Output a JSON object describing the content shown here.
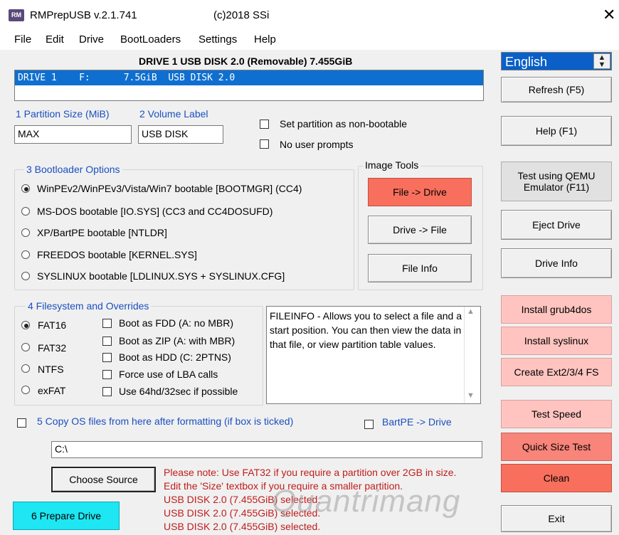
{
  "window": {
    "app_icon": "RM",
    "title": "RMPrepUSB v.2.1.741",
    "copyright": "(c)2018 SSi",
    "close_icon": "close-icon"
  },
  "menu": [
    "File",
    "Edit",
    "Drive",
    "BootLoaders",
    "Settings",
    "Help"
  ],
  "drive_header": "DRIVE 1 USB DISK 2.0  (Removable) 7.455GiB",
  "drive_list_row": "DRIVE 1    F:      7.5GiB  USB DISK 2.0",
  "language": {
    "value": "English"
  },
  "fields": {
    "partition_size_label": "1 Partition Size (MiB)",
    "partition_size_value": "MAX",
    "volume_label_label": "2 Volume Label",
    "volume_label_value": "USB DISK"
  },
  "options": {
    "non_bootable": "Set partition as non-bootable",
    "no_prompts": "No user prompts"
  },
  "bootloader": {
    "title": "3 Bootloader Options",
    "items": [
      "WinPEv2/WinPEv3/Vista/Win7 bootable [BOOTMGR] (CC4)",
      "MS-DOS bootable [IO.SYS]   (CC3 and CC4DOSUFD)",
      "XP/BartPE bootable [NTLDR]",
      "FREEDOS bootable [KERNEL.SYS]",
      "SYSLINUX bootable [LDLINUX.SYS + SYSLINUX.CFG]"
    ],
    "selected_index": 0
  },
  "image_tools": {
    "title": "Image Tools",
    "file_to_drive": "File -> Drive",
    "drive_to_file": "Drive -> File",
    "file_info": "File Info"
  },
  "filesystem": {
    "title": "4 Filesystem and Overrides",
    "types": [
      "FAT16",
      "FAT32",
      "NTFS",
      "exFAT"
    ],
    "selected_index": 0,
    "overrides": [
      "Boot as FDD (A: no MBR)",
      "Boot as ZIP (A: with MBR)",
      "Boot as HDD (C: 2PTNS)",
      "Force use of LBA calls",
      "Use 64hd/32sec if possible"
    ]
  },
  "info_text": "FILEINFO - Allows you to select a file and a start position. You can then view the data in that file, or view partition table values.",
  "copy_os": {
    "label": "5 Copy OS files from here after formatting (if box is ticked)",
    "bartpe_label": "BartPE -> Drive",
    "path_value": "C:\\"
  },
  "buttons": {
    "refresh": "Refresh (F5)",
    "help": "Help (F1)",
    "qemu": "Test using QEMU Emulator (F11)",
    "eject": "Eject Drive",
    "drive_info": "Drive Info",
    "grub4dos": "Install grub4dos",
    "syslinux": "Install syslinux",
    "ext": "Create Ext2/3/4 FS",
    "test_speed": "Test Speed",
    "quick_size": "Quick Size Test",
    "clean": "Clean",
    "choose_source": "Choose Source",
    "prepare": "6 Prepare Drive",
    "exit": "Exit"
  },
  "notes": [
    "Please note: Use FAT32 if you require a partition over 2GB in size.",
    "Edit the 'Size' textbox if you require a smaller partition.",
    "USB DISK 2.0 (7.455GiB) selected.",
    "USB DISK 2.0 (7.455GiB) selected.",
    "USB DISK 2.0 (7.455GiB) selected."
  ],
  "watermark": "Quantrimang",
  "colors": {
    "selection_blue": "#0f6fd0",
    "pink_button": "#ffc4c0",
    "red_button": "#f86f5d",
    "cyan_button": "#1ee6f2",
    "label_blue": "#1a4fc0",
    "note_red": "#c01c1c"
  }
}
